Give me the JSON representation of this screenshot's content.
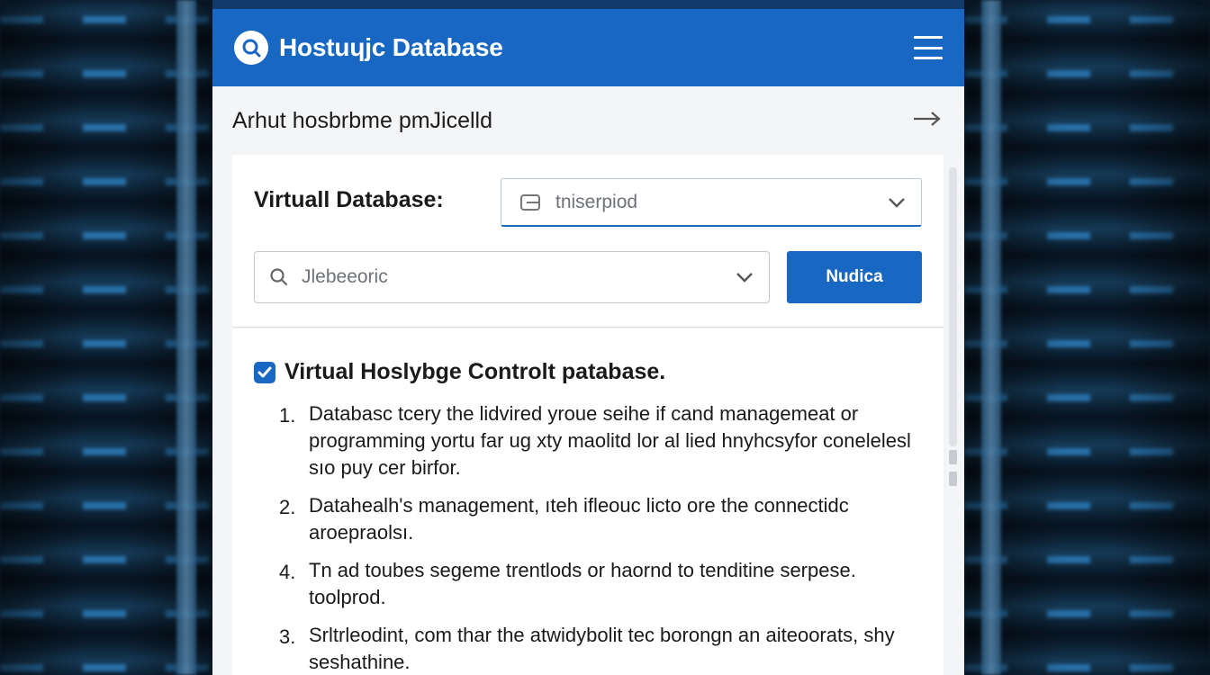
{
  "app": {
    "title": "Hostuɥjc Database"
  },
  "subheader": {
    "title": "Arhut hosbrbme pmJicelld"
  },
  "form": {
    "label": "Virtuall Database:",
    "select_value": "tniserpiod",
    "search_value": "Jlebeeoric",
    "primary_button": "Nudica"
  },
  "content": {
    "checkbox_label": "Virtual Hoslybge Controlt patabase.",
    "checkbox_checked": true,
    "items": [
      {
        "num": "1.",
        "text": "Databasc tcery the lidvired yroue seihe if cand managemeat or programming yortu far ug xty maolitd lor al lied hnyhcsyfor conelelesl sıo puy cer birfor."
      },
      {
        "num": "2.",
        "text": "Datahealh's management, ıteh ifleouc licto ore the connectidc aroepraolsı."
      },
      {
        "num": "4.",
        "text": "Tn ad toubes segeme trentlods or haornd to tenditine serpese. toolprod."
      },
      {
        "num": "3.",
        "text": "Srltrleodint, com thar the atwidybolit tec borongn an aiteoorats, shy seshathine."
      }
    ]
  },
  "colors": {
    "brand": "#1767c3",
    "background": "#0b1a2c"
  },
  "icons": [
    "search-logo-icon",
    "menu-icon",
    "arrow-right-icon",
    "database-icon",
    "chevron-down-icon",
    "search-icon",
    "checkmark-icon"
  ]
}
